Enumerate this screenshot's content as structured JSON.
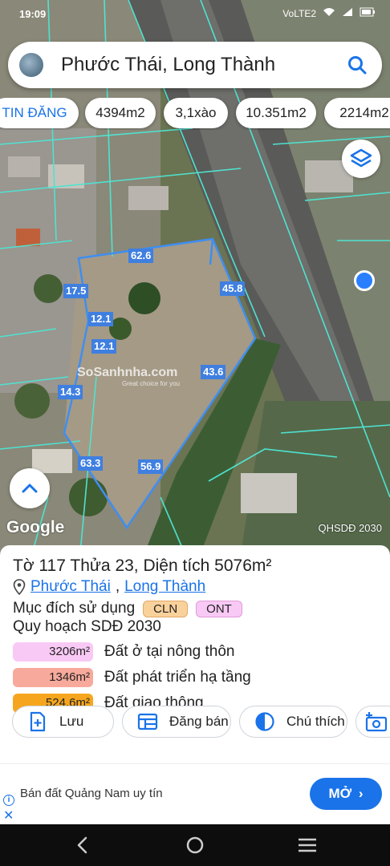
{
  "status": {
    "time": "19:09",
    "net": "VoLTE2"
  },
  "search": {
    "text": "Phước Thái, Long Thành"
  },
  "chips": [
    "TIN ĐĂNG",
    "4394m2",
    "3,1xào",
    "10.351m2",
    "2214m2"
  ],
  "map": {
    "dimensions": [
      "62.6",
      "17.5",
      "45.8",
      "12.1",
      "12.1",
      "43.6",
      "14.3",
      "63.3",
      "56.9"
    ],
    "watermark_main": "SoSanhnha.com",
    "watermark_sub": "Great choice for you",
    "google": "Google",
    "plan_label": "QHSDĐ 2030"
  },
  "info": {
    "title": "Tờ 117 Thửa 23, Diện tích 5076m²",
    "ward": "Phước Thái",
    "separator": ",",
    "district": "Long Thành",
    "purpose_label": "Mục đích sử dụng",
    "tag_cln": "CLN",
    "tag_ont": "ONT",
    "plan_title": "Quy hoạch SDĐ 2030",
    "legend": [
      {
        "value": "3206m²",
        "label": "Đất ở tại nông thôn",
        "color": "#f9c9f5"
      },
      {
        "value": "1346m²",
        "label": "Đất phát triển hạ tầng",
        "color": "#f7a99b"
      },
      {
        "value": "524.6m²",
        "label": "Đất giao thông",
        "color": "#f6a61e"
      }
    ]
  },
  "actions": {
    "save": "Lưu",
    "post": "Đăng bán",
    "notes": "Chú thích"
  },
  "ad": {
    "text": "Bán đất Quảng Nam uy tín",
    "button": "MỞ"
  },
  "colors": {
    "accent": "#1a73e8",
    "parcel": "#4ee3d0",
    "plot_line": "#3f8ef0"
  }
}
